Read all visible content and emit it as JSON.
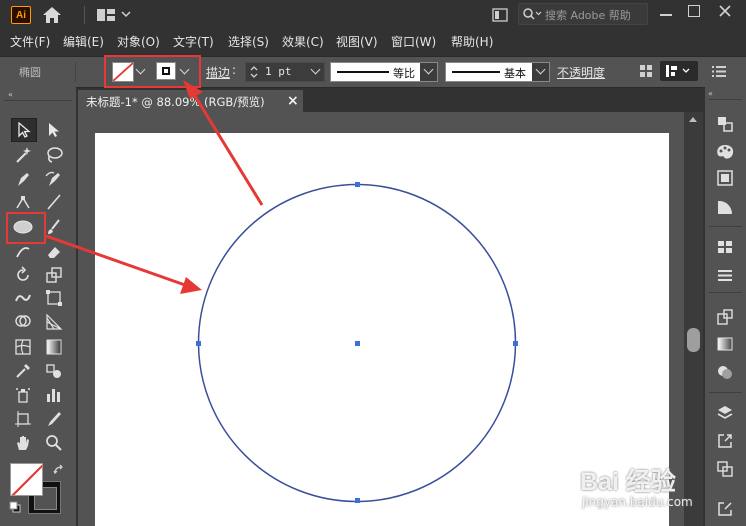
{
  "app": {
    "logo_text": "Ai"
  },
  "search": {
    "placeholder": "搜索 Adobe 帮助"
  },
  "menu": [
    "文件(F)",
    "编辑(E)",
    "对象(O)",
    "文字(T)",
    "选择(S)",
    "效果(C)",
    "视图(V)",
    "窗口(W)",
    "帮助(H)"
  ],
  "control": {
    "object_type": "椭圆",
    "stroke_label": "描边",
    "stroke_weight": "1 pt",
    "profile_label": "等比",
    "brush_label": "基本",
    "opacity_label": "不透明度"
  },
  "document_tab": {
    "title": "未标题-1* @ 88.09% (RGB/预览)",
    "close": "×"
  },
  "watermark": {
    "brand": "Bai 经验",
    "url": "jingyan.baidu.com"
  },
  "colors": {
    "accent": "#e53935",
    "selection": "#3a70d8",
    "artboard": "#ffffff",
    "panel": "#535353"
  }
}
